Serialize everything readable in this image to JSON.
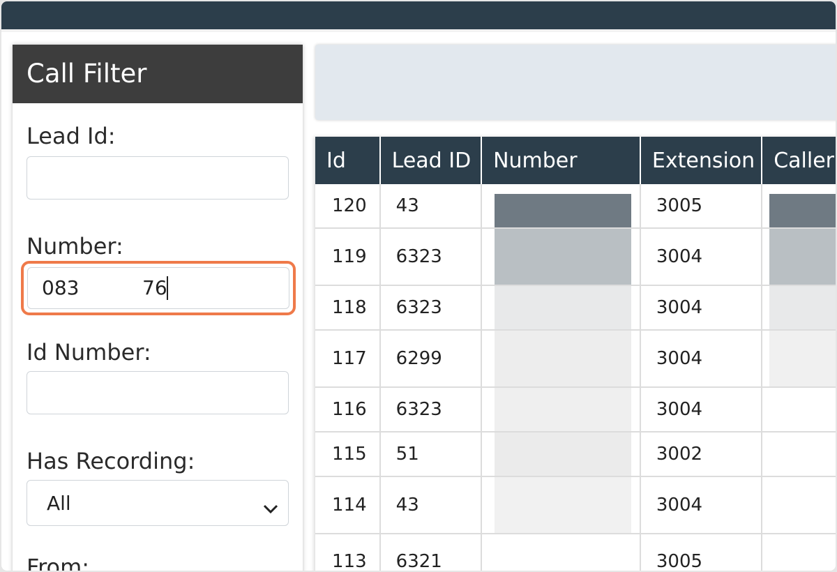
{
  "filter": {
    "title": "Call Filter",
    "lead_id_label": "Lead Id:",
    "lead_id_value": "",
    "number_label": "Number:",
    "number_value_start": "083",
    "number_value_end": "76",
    "id_number_label": "Id Number:",
    "id_number_value": "",
    "has_recording_label": "Has Recording:",
    "has_recording_value": "All",
    "from_label": "From:"
  },
  "table": {
    "columns": [
      "Id",
      "Lead ID",
      "Number",
      "Extension",
      "Caller"
    ],
    "rows": [
      {
        "id": "120",
        "lead_id": "43",
        "extension": "3005"
      },
      {
        "id": "119",
        "lead_id": "6323",
        "extension": "3004"
      },
      {
        "id": "118",
        "lead_id": "6323",
        "extension": "3004"
      },
      {
        "id": "117",
        "lead_id": "6299",
        "extension": "3004"
      },
      {
        "id": "116",
        "lead_id": "6323",
        "extension": "3004"
      },
      {
        "id": "115",
        "lead_id": "51",
        "extension": "3002"
      },
      {
        "id": "114",
        "lead_id": "43",
        "extension": "3004"
      },
      {
        "id": "113",
        "lead_id": "6321",
        "extension": "3005"
      }
    ]
  },
  "icons": {
    "select_chevron": "chevron-down-icon"
  },
  "colors": {
    "header_bg": "#2c3e4b",
    "panel_head_bg": "#3d3d3d",
    "highlight": "#ef7a4a"
  }
}
